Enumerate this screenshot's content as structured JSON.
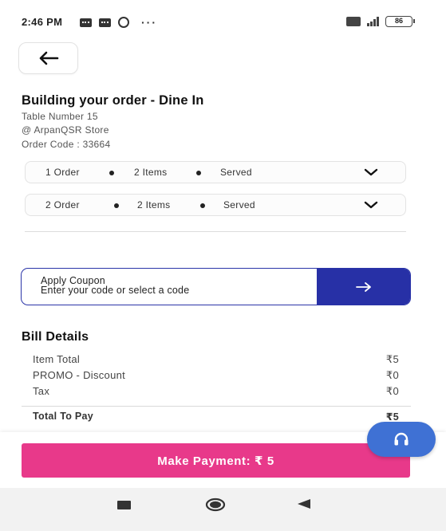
{
  "status_bar": {
    "time": "2:46 PM",
    "battery": "86",
    "network": "4G"
  },
  "header": {
    "back_icon": "arrow-left-icon"
  },
  "order_info": {
    "title": "Building your order - Dine In",
    "table": "Table Number 15",
    "store": "@ ArpanQSR Store",
    "order_code": "Order Code : 33664"
  },
  "orders": [
    {
      "order": "1 Order",
      "items": "2 Items",
      "status": "Served"
    },
    {
      "order": "2 Order",
      "items": "2 Items",
      "status": "Served"
    }
  ],
  "coupon": {
    "title": "Apply Coupon",
    "subtitle": "Enter your code or select a code",
    "arrow_icon": "arrow-right-icon",
    "accent_color": "#2730a6"
  },
  "bill": {
    "title": "Bill Details",
    "rows": [
      {
        "label": "Item Total",
        "amount": "₹5"
      },
      {
        "label": "PROMO - Discount",
        "amount": "₹0"
      },
      {
        "label": "Tax",
        "amount": "₹0"
      }
    ],
    "total_label": "Total To Pay",
    "total_amount": "₹5"
  },
  "payment": {
    "button_label": "Make Payment: ₹ 5",
    "button_color": "#e8398a"
  },
  "support": {
    "icon": "headset-icon",
    "color": "#3f71d4"
  },
  "nav": {
    "recents_icon": "recents-square-icon",
    "home_icon": "home-circle-icon",
    "back_icon": "back-triangle-icon"
  }
}
